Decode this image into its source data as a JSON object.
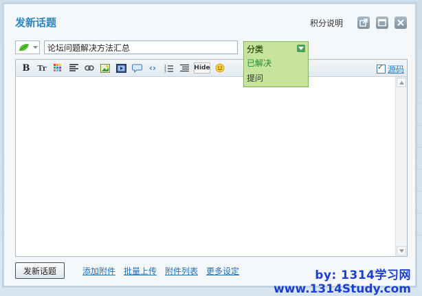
{
  "dialog": {
    "title": "发新话题",
    "score_link": "积分说明",
    "buttons": [
      "popout-icon",
      "maximize-icon",
      "close-icon"
    ]
  },
  "subject": {
    "value": "论坛问题解决方法汇总",
    "icon": "leaf-icon"
  },
  "category": {
    "header": "分类",
    "options": [
      "已解决",
      "提问"
    ],
    "colors": {
      "background": "#c6e49a",
      "border": "#7fb45a",
      "selected": "#2c8a3a"
    }
  },
  "toolbar": {
    "items": [
      "bold-icon",
      "text-size-icon",
      "color-icon",
      "align-icon",
      "link-icon",
      "image-icon",
      "media-icon",
      "quote-icon",
      "code-icon",
      "ordered-list-icon",
      "unordered-list-icon",
      "hide-icon",
      "smiley-icon"
    ],
    "hide_label": "Hide",
    "size_label": "Tr",
    "source_label": "源码",
    "source_checked": true
  },
  "footer": {
    "submit_label": "发新话题",
    "links": [
      "添加附件",
      "批量上传",
      "附件列表",
      "更多设定"
    ]
  },
  "watermark": {
    "line1": "by: 1314学习网",
    "line2": "www.1314Study.com"
  },
  "colors": {
    "title": "#2a87c5",
    "link": "#1f6fb8",
    "watermark": "#1a3fd1"
  }
}
